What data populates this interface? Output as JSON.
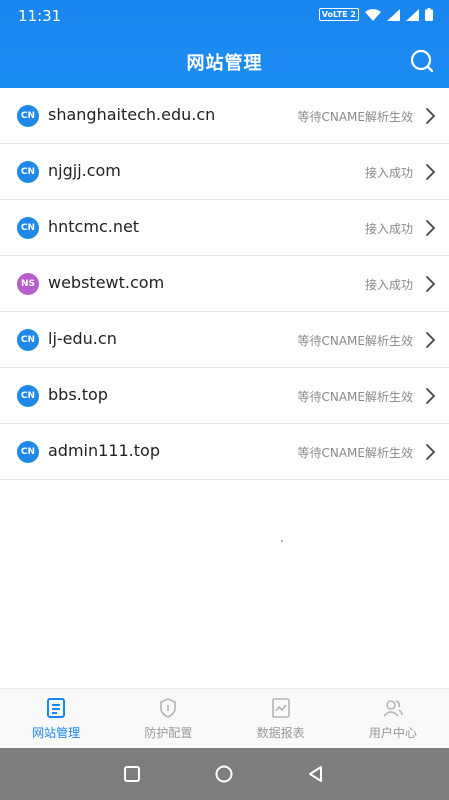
{
  "status_bar": {
    "time": "11:31",
    "network_badge": "VoLTE 2"
  },
  "header": {
    "title": "网站管理",
    "search_icon": "search-icon"
  },
  "sites": [
    {
      "badge": "CN",
      "domain": "shanghaitech.edu.cn",
      "status": "等待CNAME解析生效"
    },
    {
      "badge": "CN",
      "domain": "njgjj.com",
      "status": "接入成功"
    },
    {
      "badge": "CN",
      "domain": "hntcmc.net",
      "status": "接入成功"
    },
    {
      "badge": "NS",
      "domain": "webstewt.com",
      "status": "接入成功"
    },
    {
      "badge": "CN",
      "domain": "lj-edu.cn",
      "status": "等待CNAME解析生效"
    },
    {
      "badge": "CN",
      "domain": "bbs.top",
      "status": "等待CNAME解析生效"
    },
    {
      "badge": "CN",
      "domain": "admin111.top",
      "status": "等待CNAME解析生效"
    }
  ],
  "tabbar": {
    "tabs": [
      {
        "label": "网站管理",
        "icon": "list-doc-icon",
        "active": true
      },
      {
        "label": "防护配置",
        "icon": "shield-icon",
        "active": false
      },
      {
        "label": "数据报表",
        "icon": "chart-report-icon",
        "active": false
      },
      {
        "label": "用户中心",
        "icon": "users-icon",
        "active": false
      }
    ]
  },
  "colors": {
    "primary": "#1a86f0",
    "cn_badge": "#1f8ae6",
    "ns_badge": "#b65fcc",
    "status_text": "#8a8a8a",
    "nav_bar": "#7d7d7d"
  }
}
